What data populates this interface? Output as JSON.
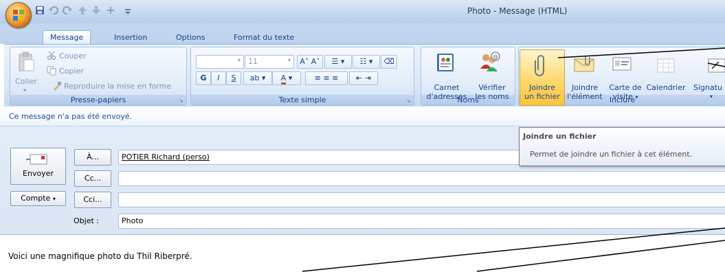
{
  "window": {
    "title": "Photo - Message (HTML)"
  },
  "tabs": [
    {
      "label": "Message"
    },
    {
      "label": "Insertion"
    },
    {
      "label": "Options"
    },
    {
      "label": "Format du texte"
    }
  ],
  "clipboard": {
    "paste": "Coller",
    "cut": "Couper",
    "copy": "Copier",
    "format_painter": "Reproduire la mise en forme",
    "group_label": "Presse-papiers"
  },
  "basic_text": {
    "font_size": "11",
    "bold": "G",
    "italic": "I",
    "underline": "S",
    "group_label": "Texte simple"
  },
  "names": {
    "address_book_l1": "Carnet",
    "address_book_l2": "d'adresses",
    "check_names_l1": "Vérifier",
    "check_names_l2": "les noms",
    "group_label": "Noms"
  },
  "include": {
    "attach_file_l1": "Joindre",
    "attach_file_l2": "un fichier",
    "attach_item_l1": "Joindre",
    "attach_item_l2": "l'élément",
    "business_card_l1": "Carte de",
    "business_card_l2": "visite",
    "calendar": "Calendrier",
    "signature": "Signatu",
    "group_label": "Inclure"
  },
  "infobar": {
    "text": "Ce message n'a pas été envoyé."
  },
  "compose": {
    "send": "Envoyer",
    "account": "Compte",
    "to_button": "À...",
    "cc_button": "Cc...",
    "bcc_button": "Cci...",
    "to_value": "POTIER Richard (perso)",
    "cc_value": "",
    "bcc_value": "",
    "subject_label": "Objet :",
    "subject_value": "Photo"
  },
  "tooltip": {
    "title": "Joindre un fichier",
    "description": "Permet de joindre un fichier à cet élément."
  },
  "body": {
    "text": "Voici une magnifique photo du Thil Riberpré."
  },
  "colors": {
    "ribbon": "#d8e6f7",
    "accent": "#15428b",
    "highlight": "#ffd86e"
  }
}
